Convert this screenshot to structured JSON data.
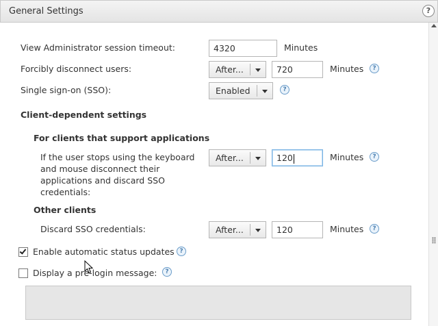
{
  "dialog": {
    "title": "General Settings",
    "help_symbol": "?"
  },
  "fields": {
    "session_timeout": {
      "label": "View Administrator session timeout:",
      "value": "4320",
      "unit": "Minutes"
    },
    "force_disconnect": {
      "label": "Forcibly disconnect users:",
      "select": "After...",
      "value": "720",
      "unit": "Minutes"
    },
    "sso": {
      "label": "Single sign-on (SSO):",
      "select": "Enabled"
    }
  },
  "client_settings": {
    "heading": "Client-dependent settings",
    "apps_heading": "For clients that support applications",
    "apps_label_lines": [
      "If the user stops using the keyboard",
      "and mouse disconnect their",
      "applications and discard SSO",
      "credentials:"
    ],
    "apps_select": "After...",
    "apps_value": "120",
    "apps_unit": "Minutes",
    "other_heading": "Other clients",
    "other_label": "Discard SSO credentials:",
    "other_select": "After...",
    "other_value": "120",
    "other_unit": "Minutes"
  },
  "checkboxes": {
    "status_updates": {
      "label": "Enable automatic status updates",
      "checked": true
    },
    "prelogin": {
      "label": "Display a pre-login message:",
      "checked": false
    }
  },
  "icons": {
    "help": "help-icon",
    "info": "question-icon",
    "scroll_up": "scroll-up-arrow-icon",
    "pointer": "mouse-pointer-icon"
  }
}
